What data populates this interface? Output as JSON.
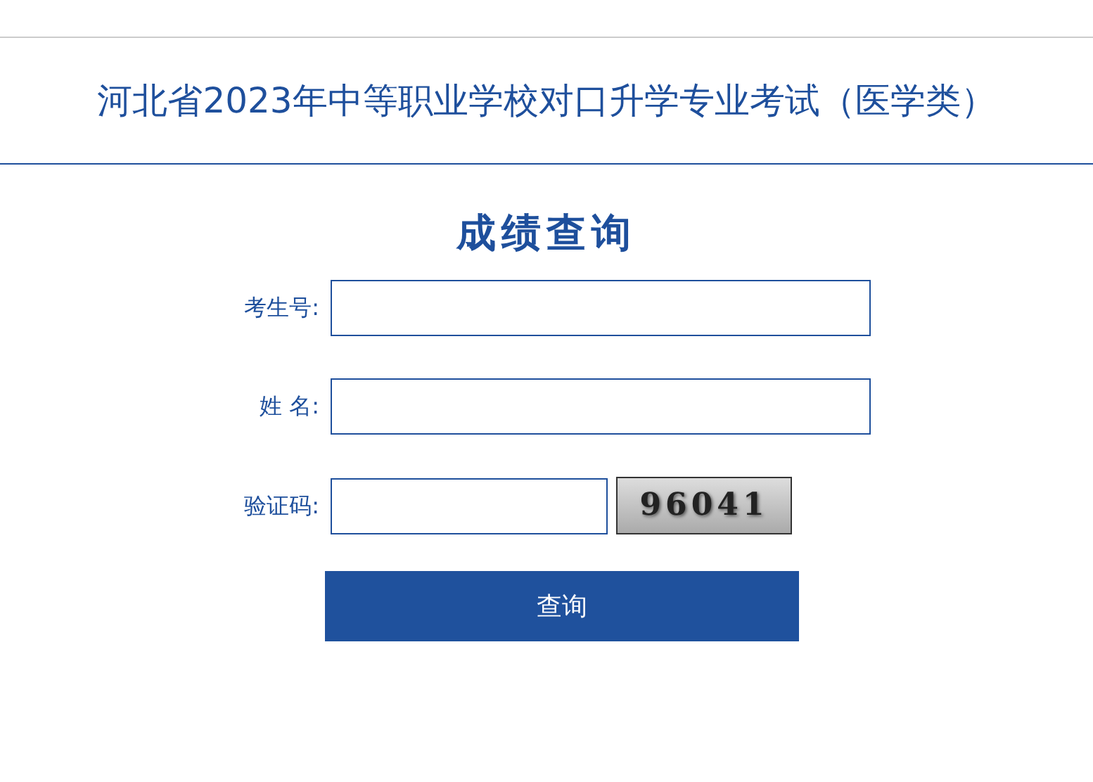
{
  "header": {
    "title": "河北省2023年中等职业学校对口升学专业考试（医学类）"
  },
  "form": {
    "heading": "成绩查询",
    "fields": [
      {
        "kind": "text",
        "label": "考生号:"
      },
      {
        "kind": "text",
        "label": "姓 名:"
      },
      {
        "kind": "captcha",
        "label": "验证码:",
        "captcha": "96041"
      }
    ],
    "submit": "查询"
  }
}
